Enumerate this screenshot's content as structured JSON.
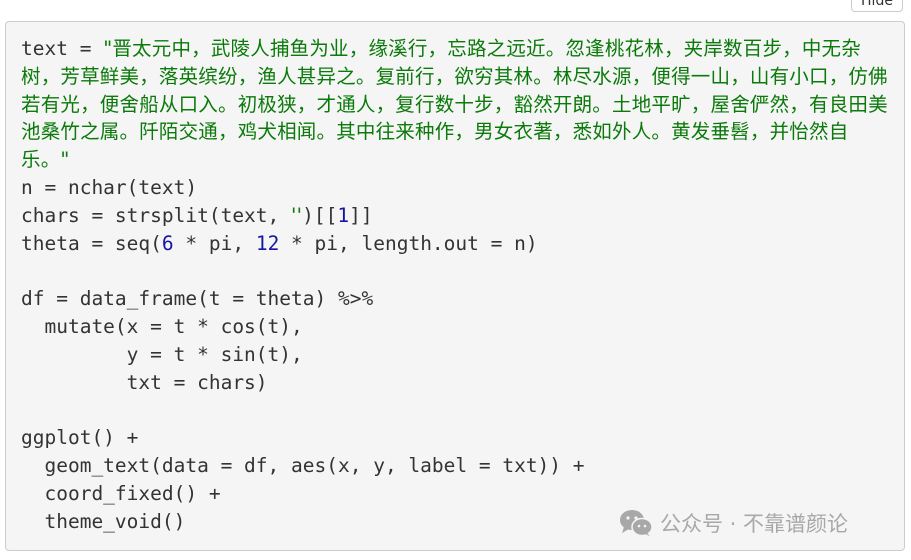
{
  "toolbar": {
    "hide_label": "Hide"
  },
  "code": {
    "language": "r",
    "lines": [
      {
        "segments": [
          {
            "t": "text = ",
            "c": "plain"
          },
          {
            "t": "\"晋太元中，武陵人捕鱼为业，缘溪行，忘路之远近。忽逢桃花林，夹岸数百步，中无杂",
            "c": "str"
          }
        ]
      },
      {
        "segments": [
          {
            "t": "树，芳草鲜美，落英缤纷，渔人甚异之。复前行，欲穷其林。林尽水源，便得一山，山有小口，仿佛",
            "c": "str"
          }
        ]
      },
      {
        "segments": [
          {
            "t": "若有光，便舍船从口入。初极狭，才通人，复行数十步，豁然开朗。土地平旷，屋舍俨然，有良田美",
            "c": "str"
          }
        ]
      },
      {
        "segments": [
          {
            "t": "池桑竹之属。阡陌交通，鸡犬相闻。其中往来种作，男女衣著，悉如外人。黄发垂髫，并怡然自",
            "c": "str"
          }
        ]
      },
      {
        "segments": [
          {
            "t": "乐。\"",
            "c": "str"
          }
        ]
      },
      {
        "segments": [
          {
            "t": "n = nchar(text)",
            "c": "plain"
          }
        ]
      },
      {
        "segments": [
          {
            "t": "chars = strsplit(text, ",
            "c": "plain"
          },
          {
            "t": "''",
            "c": "str"
          },
          {
            "t": ")[[",
            "c": "plain"
          },
          {
            "t": "1",
            "c": "num"
          },
          {
            "t": "]]",
            "c": "plain"
          }
        ]
      },
      {
        "segments": [
          {
            "t": "theta = seq(",
            "c": "plain"
          },
          {
            "t": "6",
            "c": "num"
          },
          {
            "t": " * pi, ",
            "c": "plain"
          },
          {
            "t": "12",
            "c": "num"
          },
          {
            "t": " * pi, length.out = n)",
            "c": "plain"
          }
        ]
      },
      {
        "segments": [
          {
            "t": "",
            "c": "plain"
          }
        ]
      },
      {
        "segments": [
          {
            "t": "df = data_frame(t = theta) %>%",
            "c": "plain"
          }
        ]
      },
      {
        "segments": [
          {
            "t": "  mutate(x = t * cos(t),",
            "c": "plain"
          }
        ]
      },
      {
        "segments": [
          {
            "t": "         y = t * sin(t),",
            "c": "plain"
          }
        ]
      },
      {
        "segments": [
          {
            "t": "         txt = chars)",
            "c": "plain"
          }
        ]
      },
      {
        "segments": [
          {
            "t": "",
            "c": "plain"
          }
        ]
      },
      {
        "segments": [
          {
            "t": "ggplot() +",
            "c": "plain"
          }
        ]
      },
      {
        "segments": [
          {
            "t": "  geom_text(data = df, aes(x, y, label = txt)) +",
            "c": "plain"
          }
        ]
      },
      {
        "segments": [
          {
            "t": "  coord_fixed() +",
            "c": "plain"
          }
        ]
      },
      {
        "segments": [
          {
            "t": "  theme_void()",
            "c": "plain"
          }
        ]
      }
    ]
  },
  "watermark": {
    "icon": "wechat-icon",
    "text": "公众号 · 不靠谱颜论"
  },
  "colors": {
    "string": "#0b7a0b",
    "number": "#1515a6",
    "plain": "#333333",
    "code_bg": "#f5f5f5",
    "watermark": "#a8a8a8"
  }
}
